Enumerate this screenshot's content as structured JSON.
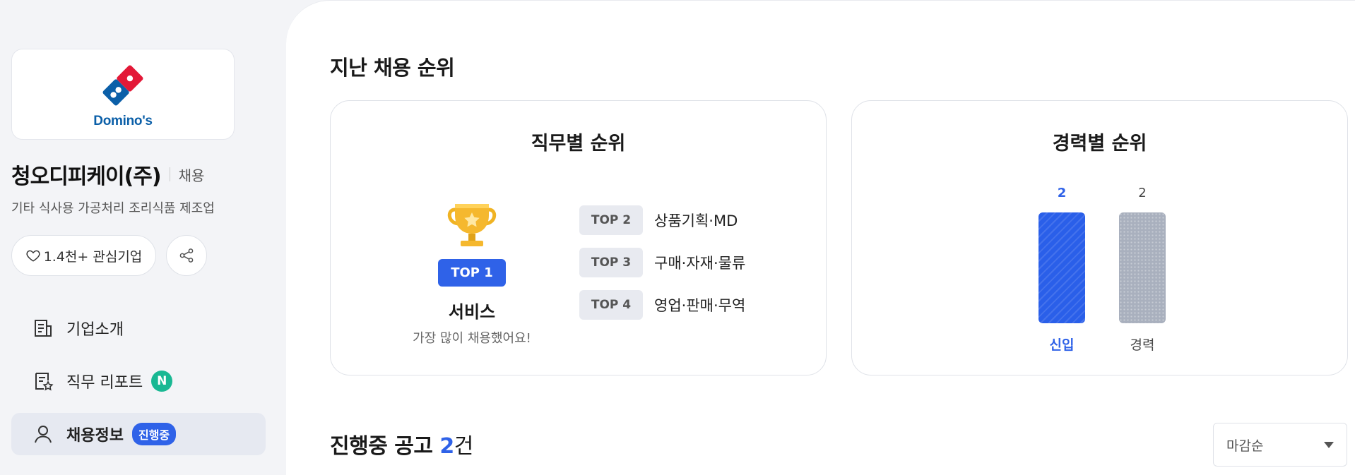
{
  "company": {
    "logo_text": "Domino's",
    "name": "청오디피케이(주)",
    "tag": "채용",
    "industry": "기타 식사용 가공처리 조리식품 제조업",
    "follow_label": "1.4천+ 관심기업"
  },
  "sidebar": {
    "items": [
      {
        "label": "기업소개",
        "icon": "building-doc-icon"
      },
      {
        "label": "직무 리포트",
        "icon": "report-star-icon",
        "badge": "N"
      },
      {
        "label": "채용정보",
        "icon": "person-icon",
        "badge": "진행중",
        "active": true
      }
    ]
  },
  "main": {
    "section_title": "지난 채용 순위",
    "job_rank": {
      "title": "직무별 순위",
      "top1": {
        "badge": "TOP 1",
        "name": "서비스",
        "sub": "가장 많이 채용했어요!"
      },
      "list": [
        {
          "rank": "TOP 2",
          "label": "상품기획·MD"
        },
        {
          "rank": "TOP 3",
          "label": "구매·자재·물류"
        },
        {
          "rank": "TOP 4",
          "label": "영업·판매·무역"
        }
      ]
    },
    "career_rank": {
      "title": "경력별 순위"
    },
    "ongoing": {
      "title": "진행중 공고",
      "count": "2",
      "unit": "건"
    },
    "sort": {
      "label": "마감순"
    }
  },
  "chart_data": {
    "type": "bar",
    "categories": [
      "신입",
      "경력"
    ],
    "values": [
      2,
      2
    ],
    "value_labels": [
      "2",
      "2"
    ],
    "colors": {
      "신입": "#2a5fe9",
      "경력": "#a9b0be"
    },
    "highlight": "신입",
    "ylim": [
      0,
      2
    ]
  },
  "colors": {
    "accent": "#2f62e8",
    "badge_new": "#19b893"
  }
}
